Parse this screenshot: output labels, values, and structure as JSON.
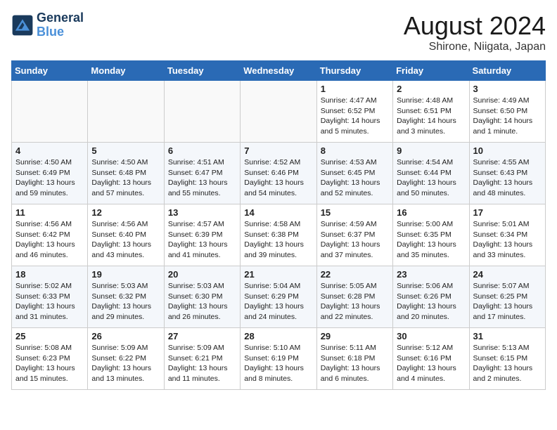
{
  "header": {
    "logo_line1": "General",
    "logo_line2": "Blue",
    "month": "August 2024",
    "location": "Shirone, Niigata, Japan"
  },
  "weekdays": [
    "Sunday",
    "Monday",
    "Tuesday",
    "Wednesday",
    "Thursday",
    "Friday",
    "Saturday"
  ],
  "weeks": [
    [
      {
        "num": "",
        "info": ""
      },
      {
        "num": "",
        "info": ""
      },
      {
        "num": "",
        "info": ""
      },
      {
        "num": "",
        "info": ""
      },
      {
        "num": "1",
        "info": "Sunrise: 4:47 AM\nSunset: 6:52 PM\nDaylight: 14 hours\nand 5 minutes."
      },
      {
        "num": "2",
        "info": "Sunrise: 4:48 AM\nSunset: 6:51 PM\nDaylight: 14 hours\nand 3 minutes."
      },
      {
        "num": "3",
        "info": "Sunrise: 4:49 AM\nSunset: 6:50 PM\nDaylight: 14 hours\nand 1 minute."
      }
    ],
    [
      {
        "num": "4",
        "info": "Sunrise: 4:50 AM\nSunset: 6:49 PM\nDaylight: 13 hours\nand 59 minutes."
      },
      {
        "num": "5",
        "info": "Sunrise: 4:50 AM\nSunset: 6:48 PM\nDaylight: 13 hours\nand 57 minutes."
      },
      {
        "num": "6",
        "info": "Sunrise: 4:51 AM\nSunset: 6:47 PM\nDaylight: 13 hours\nand 55 minutes."
      },
      {
        "num": "7",
        "info": "Sunrise: 4:52 AM\nSunset: 6:46 PM\nDaylight: 13 hours\nand 54 minutes."
      },
      {
        "num": "8",
        "info": "Sunrise: 4:53 AM\nSunset: 6:45 PM\nDaylight: 13 hours\nand 52 minutes."
      },
      {
        "num": "9",
        "info": "Sunrise: 4:54 AM\nSunset: 6:44 PM\nDaylight: 13 hours\nand 50 minutes."
      },
      {
        "num": "10",
        "info": "Sunrise: 4:55 AM\nSunset: 6:43 PM\nDaylight: 13 hours\nand 48 minutes."
      }
    ],
    [
      {
        "num": "11",
        "info": "Sunrise: 4:56 AM\nSunset: 6:42 PM\nDaylight: 13 hours\nand 46 minutes."
      },
      {
        "num": "12",
        "info": "Sunrise: 4:56 AM\nSunset: 6:40 PM\nDaylight: 13 hours\nand 43 minutes."
      },
      {
        "num": "13",
        "info": "Sunrise: 4:57 AM\nSunset: 6:39 PM\nDaylight: 13 hours\nand 41 minutes."
      },
      {
        "num": "14",
        "info": "Sunrise: 4:58 AM\nSunset: 6:38 PM\nDaylight: 13 hours\nand 39 minutes."
      },
      {
        "num": "15",
        "info": "Sunrise: 4:59 AM\nSunset: 6:37 PM\nDaylight: 13 hours\nand 37 minutes."
      },
      {
        "num": "16",
        "info": "Sunrise: 5:00 AM\nSunset: 6:35 PM\nDaylight: 13 hours\nand 35 minutes."
      },
      {
        "num": "17",
        "info": "Sunrise: 5:01 AM\nSunset: 6:34 PM\nDaylight: 13 hours\nand 33 minutes."
      }
    ],
    [
      {
        "num": "18",
        "info": "Sunrise: 5:02 AM\nSunset: 6:33 PM\nDaylight: 13 hours\nand 31 minutes."
      },
      {
        "num": "19",
        "info": "Sunrise: 5:03 AM\nSunset: 6:32 PM\nDaylight: 13 hours\nand 29 minutes."
      },
      {
        "num": "20",
        "info": "Sunrise: 5:03 AM\nSunset: 6:30 PM\nDaylight: 13 hours\nand 26 minutes."
      },
      {
        "num": "21",
        "info": "Sunrise: 5:04 AM\nSunset: 6:29 PM\nDaylight: 13 hours\nand 24 minutes."
      },
      {
        "num": "22",
        "info": "Sunrise: 5:05 AM\nSunset: 6:28 PM\nDaylight: 13 hours\nand 22 minutes."
      },
      {
        "num": "23",
        "info": "Sunrise: 5:06 AM\nSunset: 6:26 PM\nDaylight: 13 hours\nand 20 minutes."
      },
      {
        "num": "24",
        "info": "Sunrise: 5:07 AM\nSunset: 6:25 PM\nDaylight: 13 hours\nand 17 minutes."
      }
    ],
    [
      {
        "num": "25",
        "info": "Sunrise: 5:08 AM\nSunset: 6:23 PM\nDaylight: 13 hours\nand 15 minutes."
      },
      {
        "num": "26",
        "info": "Sunrise: 5:09 AM\nSunset: 6:22 PM\nDaylight: 13 hours\nand 13 minutes."
      },
      {
        "num": "27",
        "info": "Sunrise: 5:09 AM\nSunset: 6:21 PM\nDaylight: 13 hours\nand 11 minutes."
      },
      {
        "num": "28",
        "info": "Sunrise: 5:10 AM\nSunset: 6:19 PM\nDaylight: 13 hours\nand 8 minutes."
      },
      {
        "num": "29",
        "info": "Sunrise: 5:11 AM\nSunset: 6:18 PM\nDaylight: 13 hours\nand 6 minutes."
      },
      {
        "num": "30",
        "info": "Sunrise: 5:12 AM\nSunset: 6:16 PM\nDaylight: 13 hours\nand 4 minutes."
      },
      {
        "num": "31",
        "info": "Sunrise: 5:13 AM\nSunset: 6:15 PM\nDaylight: 13 hours\nand 2 minutes."
      }
    ]
  ]
}
